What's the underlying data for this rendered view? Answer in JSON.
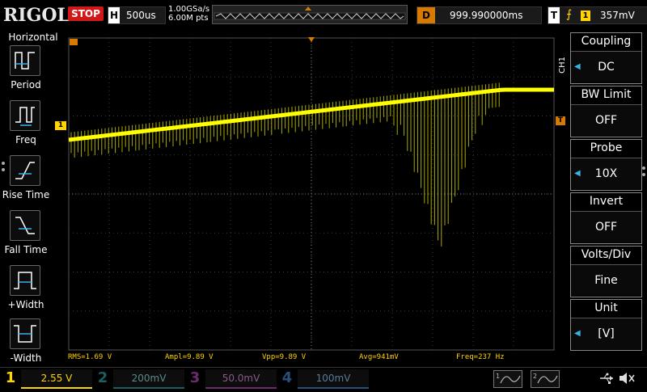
{
  "brand": "RIGOL",
  "status": "STOP",
  "horizontal": {
    "letter": "H",
    "timebase": "500us"
  },
  "acquisition": {
    "sample_rate": "1.00GSa/s",
    "points": "6.00M pts"
  },
  "delay": {
    "letter": "D",
    "value": "999.990000ms"
  },
  "trigger": {
    "letter": "T",
    "edge_symbol": "⨍",
    "source": "1",
    "level": "357mV"
  },
  "left_menu": {
    "title": "Horizontal",
    "items": [
      {
        "label": "Period",
        "icon": "period-icon"
      },
      {
        "label": "Freq",
        "icon": "frequency-icon"
      },
      {
        "label": "Rise Time",
        "icon": "rise-time-icon"
      },
      {
        "label": "Fall Time",
        "icon": "fall-time-icon"
      },
      {
        "label": "+Width",
        "icon": "positive-width-icon"
      },
      {
        "label": "-Width",
        "icon": "negative-width-icon"
      }
    ]
  },
  "right_menu": {
    "channel_label": "CH1",
    "items": [
      {
        "title": "Coupling",
        "value": "DC"
      },
      {
        "title": "BW Limit",
        "value": "OFF"
      },
      {
        "title": "Probe",
        "value": "10X"
      },
      {
        "title": "Invert",
        "value": "OFF"
      },
      {
        "title": "Volts/Div",
        "value": "Fine"
      },
      {
        "title": "Unit",
        "value": "[V]"
      }
    ]
  },
  "measurements": {
    "rms": "RMS=1.69 V",
    "ampl": "Ampl=9.89 V",
    "vpp": "Vpp=9.89 V",
    "avg": "Avg=941mV",
    "freq": "Freq=237 Hz"
  },
  "channels": [
    {
      "num": "1",
      "scale": "2.55 V",
      "color": "#ffd400"
    },
    {
      "num": "2",
      "scale": "200mV",
      "color": "#2aa2a2"
    },
    {
      "num": "3",
      "scale": "50.0mV",
      "color": "#b030b0"
    },
    {
      "num": "4",
      "scale": "100mV",
      "color": "#2a6ab0"
    }
  ],
  "markers": {
    "ch1_marker": "1",
    "trigger_marker": "T"
  },
  "colors": {
    "trace": "#ffff00",
    "trace_dim": "#c8c800",
    "grid": "#3a3a3a",
    "accent": "#d97a00"
  }
}
